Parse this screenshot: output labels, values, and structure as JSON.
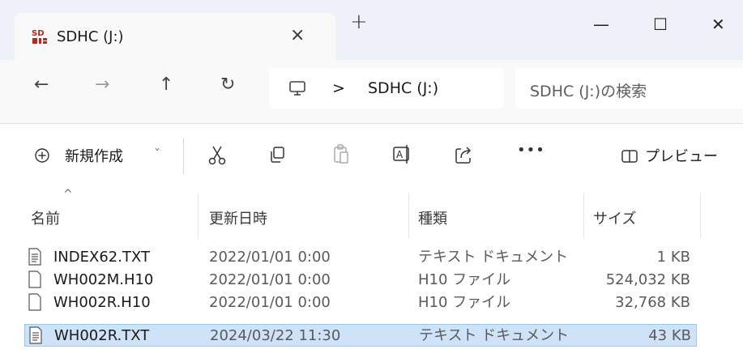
{
  "window": {
    "tab_title": "SDHC (J:)",
    "tab_close": "×",
    "new_tab": "+",
    "minimize": "—",
    "maximize": "☐",
    "close": "✕"
  },
  "nav": {
    "back": "←",
    "forward": "→",
    "up": "↑",
    "refresh": "↻",
    "breadcrumb_separator": ">",
    "location": "SDHC (J:)",
    "search_placeholder": "SDHC (J:)の検索"
  },
  "command_bar": {
    "new_label": "新規作成",
    "new_chevron": "ˇ",
    "more": "•••",
    "preview_label": "プレビュー"
  },
  "columns": {
    "name": "名前",
    "modified": "更新日時",
    "type": "種類",
    "size": "サイズ",
    "sort_indicator": "^"
  },
  "files": [
    {
      "name": "INDEX62.TXT",
      "modified": "2022/01/01 0:00",
      "type": "テキスト ドキュメント",
      "size": "1 KB",
      "icon": "text-document-icon",
      "selected": false
    },
    {
      "name": "WH002M.H10",
      "modified": "2022/01/01 0:00",
      "type": "H10 ファイル",
      "size": "524,032 KB",
      "icon": "blank-file-icon",
      "selected": false
    },
    {
      "name": "WH002R.H10",
      "modified": "2022/01/01 0:00",
      "type": "H10 ファイル",
      "size": "32,768 KB",
      "icon": "blank-file-icon",
      "selected": false
    },
    {
      "name": "WH002R.TXT",
      "modified": "2024/03/22 11:30",
      "type": "テキスト ドキュメント",
      "size": "43 KB",
      "icon": "text-document-icon",
      "selected": true
    }
  ],
  "colors": {
    "selection": "#cfe3f8",
    "selection_border": "#99c9ef",
    "sd_icon": "#c0261c"
  }
}
